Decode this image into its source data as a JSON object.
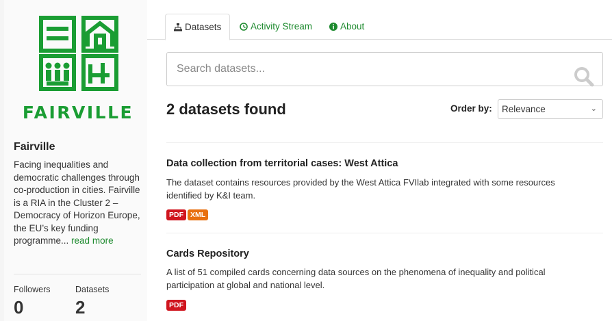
{
  "org": {
    "brand": "FAIRVILLE",
    "name": "Fairville",
    "description": "Facing inequalities and democratic challenges through co-production in cities. Fairville is a RIA in the Cluster 2 – Democracy of Horizon Europe, the EU’s key funding programme...",
    "read_more": "read more",
    "stats": {
      "followers_label": "Followers",
      "followers_value": "0",
      "datasets_label": "Datasets",
      "datasets_value": "2"
    }
  },
  "tabs": [
    {
      "label": "Datasets",
      "icon": "sitemap-icon",
      "active": true
    },
    {
      "label": "Activity Stream",
      "icon": "clock-icon",
      "active": false
    },
    {
      "label": "About",
      "icon": "info-icon",
      "active": false
    }
  ],
  "search": {
    "placeholder": "Search datasets...",
    "value": ""
  },
  "results": {
    "count_text": "2 datasets found",
    "order_label": "Order by:",
    "order_value": "Relevance"
  },
  "datasets": [
    {
      "title": "Data collection from territorial cases: West Attica",
      "description": "The dataset contains resources provided by the West Attica FVIlab integrated with some resources identified by K&I team.",
      "formats": [
        "PDF",
        "XML"
      ]
    },
    {
      "title": "Cards Repository",
      "description": "A list of 51 compiled cards concerning data sources on the phenomena of inequality and political participation at global and national level.",
      "formats": [
        "PDF"
      ]
    }
  ],
  "colors": {
    "brand_green": "#1a9d33",
    "link_green": "#1d8a2e",
    "pdf_badge": "#d0151f",
    "xml_badge": "#e8700f"
  }
}
